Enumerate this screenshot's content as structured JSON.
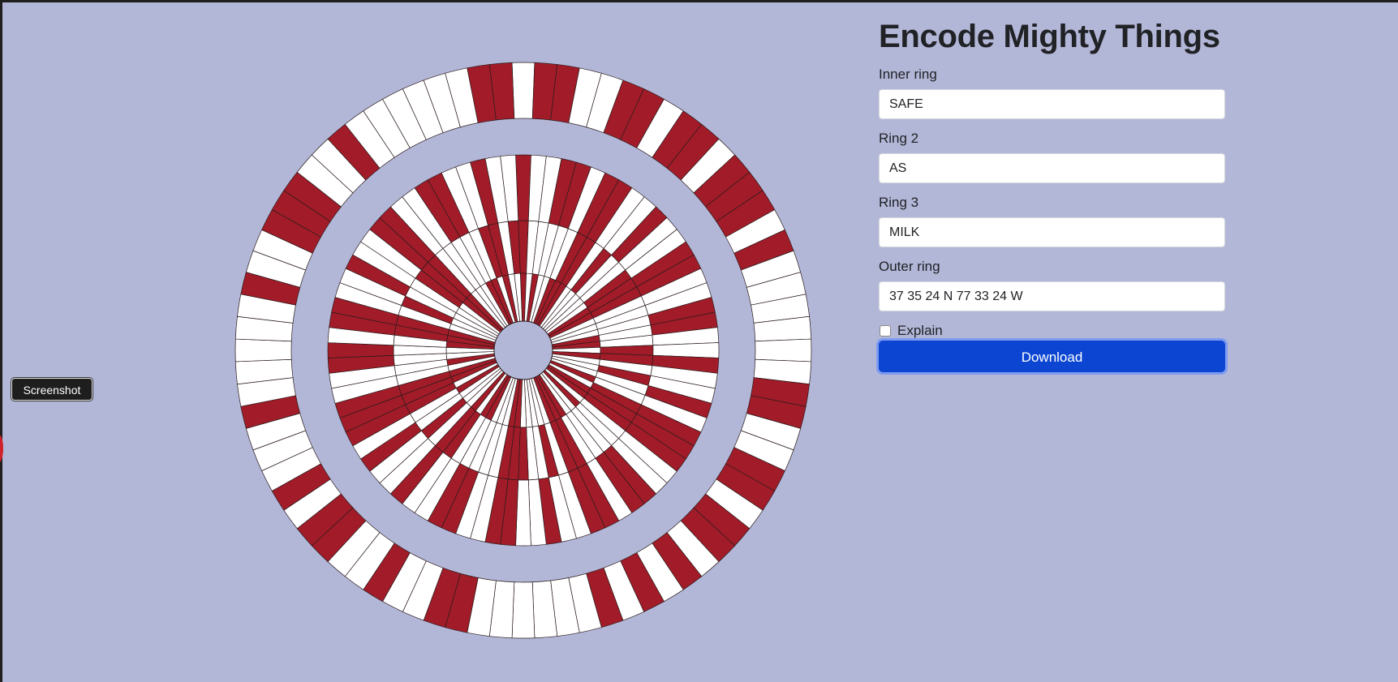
{
  "app": {
    "title": "Encode Mighty Things"
  },
  "screenshot_button": {
    "label": "Screenshot"
  },
  "form": {
    "fields": [
      {
        "id": "inner",
        "label": "Inner ring",
        "value": "SAFE"
      },
      {
        "id": "ring2",
        "label": "Ring 2",
        "value": "AS"
      },
      {
        "id": "ring3",
        "label": "Ring 3",
        "value": "MILK"
      },
      {
        "id": "outer",
        "label": "Outer ring",
        "value": "37 35 24 N 77 33 24 W"
      }
    ],
    "explain": {
      "label": "Explain",
      "checked": false
    },
    "download_label": "Download"
  },
  "colors": {
    "background": "#b3b7d7",
    "ring_on": "#a11c28",
    "ring_off": "#ffffff",
    "accent": "#0b45d1"
  },
  "parachute": {
    "gores": 80,
    "rings": [
      {
        "name": "inner",
        "text": "SAFE"
      },
      {
        "name": "ring2",
        "text": "AS"
      },
      {
        "name": "ring3",
        "text": "MILK"
      },
      {
        "name": "outer",
        "text": "37 35 24 N 77 33 24 W"
      }
    ]
  }
}
